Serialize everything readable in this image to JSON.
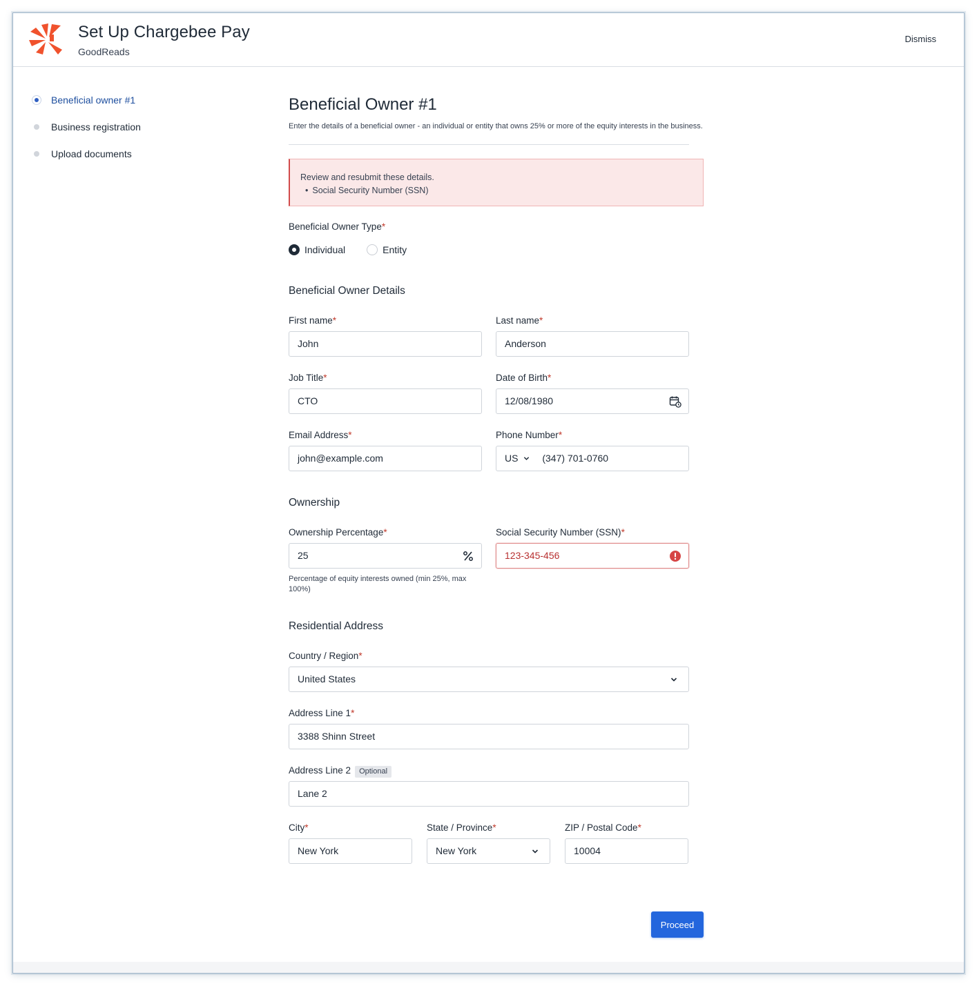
{
  "header": {
    "title": "Set Up Chargebee Pay",
    "subtitle": "GoodReads",
    "dismiss_label": "Dismiss",
    "brand_color": "#f0522d"
  },
  "steps": [
    {
      "label": "Beneficial owner #1",
      "active": true
    },
    {
      "label": "Business registration",
      "active": false
    },
    {
      "label": "Upload documents",
      "active": false
    }
  ],
  "page": {
    "title": "Beneficial Owner #1",
    "description": "Enter the details of a beneficial owner - an individual or entity that owns 25% or more of the equity interests in the business."
  },
  "alert": {
    "message": "Review and resubmit these details.",
    "items": [
      "Social Security Number (SSN)"
    ]
  },
  "owner_type": {
    "label": "Beneficial Owner Type",
    "required_mark": "*",
    "options": [
      {
        "label": "Individual",
        "checked": true
      },
      {
        "label": "Entity",
        "checked": false
      }
    ]
  },
  "details": {
    "section_title": "Beneficial Owner Details",
    "first_name": {
      "label": "First name",
      "value": "John"
    },
    "last_name": {
      "label": "Last name",
      "value": "Anderson"
    },
    "job_title": {
      "label": "Job Title",
      "value": "CTO"
    },
    "dob": {
      "label": "Date of Birth",
      "value": "12/08/1980"
    },
    "email": {
      "label": "Email Address",
      "value": "john@example.com"
    },
    "phone": {
      "label": "Phone Number",
      "country_code": "US",
      "value": "(347) 701-0760"
    }
  },
  "ownership": {
    "section_title": "Ownership",
    "percentage": {
      "label": "Ownership Percentage",
      "value": "25",
      "hint": "Percentage of equity interests owned (min 25%, max 100%)"
    },
    "ssn": {
      "label": "Social Security Number (SSN)",
      "value": "123-345-456",
      "error": true
    }
  },
  "address": {
    "section_title": "Residential Address",
    "country": {
      "label": "Country / Region",
      "value": "United States"
    },
    "line1": {
      "label": "Address Line 1",
      "value": "3388 Shinn Street"
    },
    "line2": {
      "label": "Address Line 2",
      "badge": "Optional",
      "value": "Lane 2"
    },
    "city": {
      "label": "City",
      "value": "New York"
    },
    "state": {
      "label": "State / Province",
      "value": "New York"
    },
    "zip": {
      "label": "ZIP / Postal Code",
      "value": "10004"
    }
  },
  "actions": {
    "proceed_label": "Proceed",
    "proceed_color": "#2366dd"
  },
  "icons": [
    "chargebee-logo",
    "calendar-icon",
    "percent-icon",
    "error-icon",
    "chevron-down-icon"
  ]
}
